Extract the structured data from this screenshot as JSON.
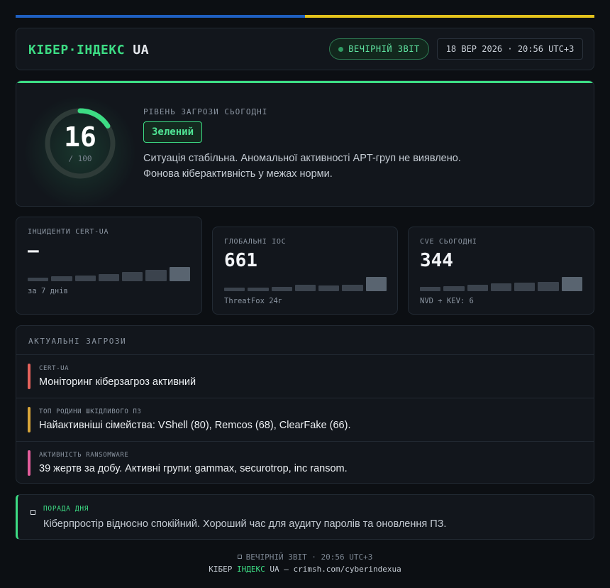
{
  "header": {
    "brand_part1": "КІБЕР·ІНДЕКС",
    "brand_part2": "UA",
    "report_badge": "ВЕЧІРНІЙ ЗВІТ",
    "datetime": "18 ВЕР 2026 · 20:56 UTC+3"
  },
  "threat_level": {
    "score": "16",
    "max": "/ 100",
    "score_value": 16,
    "score_max": 100,
    "label": "РІВЕНЬ ЗАГРОЗИ СЬОГОДНІ",
    "badge": "Зелений",
    "description_line1": "Ситуація стабільна. Аномальної активності APT-груп не виявлено.",
    "description_line2": "Фонова кіберактивність у межах норми.",
    "accent_color": "#3ddc84"
  },
  "stats": [
    {
      "label": "ІНЦИДЕНТИ CERT-UA",
      "value": "—",
      "footer": "за 7 днів"
    },
    {
      "label": "ГЛОБАЛЬНІ IOC",
      "value": "661",
      "footer": "ThreatFox 24г"
    },
    {
      "label": "CVE СЬОГОДНІ",
      "value": "344",
      "footer": "NVD + KEV: 6"
    }
  ],
  "threats": {
    "title": "АКТУАЛЬНІ ЗАГРОЗИ",
    "items": [
      {
        "tag": "CERT-UA",
        "text": "Моніторинг кіберзагроз активний",
        "color": "#e5625c"
      },
      {
        "tag": "ТОП РОДИНИ ШКІДЛИВОГО ПЗ",
        "text": "Найактивніші сімейства: VShell (80), Remcos (68), ClearFake (66).",
        "color": "#d9a63a"
      },
      {
        "tag": "АКТИВНІСТЬ RANSOMWARE",
        "text": "39 жертв за добу. Активні групи: gammax, securotrop, inc ransom.",
        "color": "#e35d9c"
      }
    ]
  },
  "tip": {
    "label": "ПОРАДА ДНЯ",
    "text": "Кіберпростір відносно спокійний. Хороший час для аудиту паролів та оновлення ПЗ."
  },
  "footer": {
    "line1": "ВЕЧІРНІЙ ЗВІТ · 20:56 UTC+3",
    "brand_a": "КІБЕР ",
    "brand_b": "ІНДЕКС",
    "brand_c": " UA — crimsh.com/cyberindexua"
  }
}
